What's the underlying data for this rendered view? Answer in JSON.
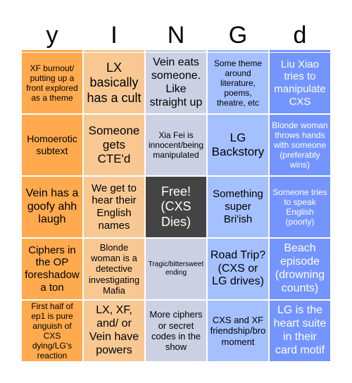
{
  "header": {
    "letters": [
      "y",
      "I",
      "N",
      "G",
      "d"
    ],
    "column_colors": [
      "#FFAA4E",
      "#F8C893",
      "#CBD0E3",
      "#A4C0FF",
      "#7495FF"
    ]
  },
  "free_space_color": "#444444",
  "rows": [
    [
      "XF burnout/ putting up a front explored as a theme",
      "LX basically has a cult",
      "Vein eats someone. Like straight up",
      "Some theme around literature, poems, theatre, etc",
      "Liu Xiao tries to manipulate CXS"
    ],
    [
      "Homoerotic subtext",
      "Someone gets CTE'd",
      "Xia Fei is innocent/being manipulated",
      "LG Backstory",
      "Blonde woman throws hands with someone (preferably wins)"
    ],
    [
      "Vein has a goofy ahh laugh",
      "We get to hear their English names",
      "Free! (CXS Dies)",
      "Something super Bri'ish",
      "Someone tries to speak English (poorly)"
    ],
    [
      "Ciphers in the OP foreshadow a ton",
      "Blonde woman is a detective investigating Mafia",
      "Tragic/bittersweet ending",
      "Road Trip? (CXS or LG drives)",
      "Beach episode (drowning counts)"
    ],
    [
      "First half of ep1 is pure anguish of CXS dying/LG's reaction",
      "LX, XF, and/ or Vein have powers",
      "More ciphers or secret codes in the show",
      "CXS and XF friendship/bro moment",
      "LG is the heart suite in their card motif"
    ]
  ]
}
